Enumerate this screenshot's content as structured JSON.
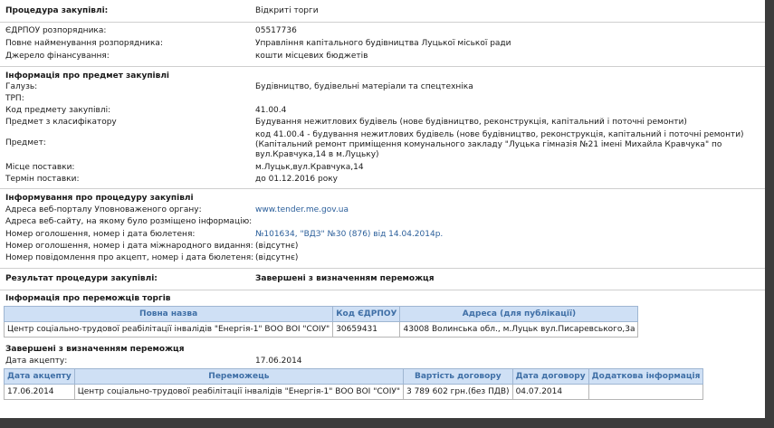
{
  "procurement": {
    "procedure_label": "Процедура закупівлі:",
    "procedure_value": "Відкриті торги",
    "edrpou_label": "ЄДРПОУ розпорядника:",
    "edrpou_value": "05517736",
    "full_name_label": "Повне найменування розпорядника:",
    "full_name_value": "Управління капітального будівництва Луцької міської ради",
    "funding_label": "Джерело фінансування:",
    "funding_value": "кошти місцевих бюджетів"
  },
  "subject": {
    "heading": "Інформація про предмет закупівлі",
    "industry_label": "Галузь:",
    "industry_value": "Будівництво, будівельні матеріали та спецтехніка",
    "trp_label": "ТРП:",
    "code_label": "Код предмету закупівлі:",
    "code_value": "41.00.4",
    "classifier_label": "Предмет з класифікатору",
    "classifier_value": "Будування нежитлових будівель (нове будівництво, реконструкція, капітальний і поточні ремонти)",
    "subject_label": "Предмет:",
    "subject_line1": "код 41.00.4 - будування нежитлових будівель (нове будівництво, реконструкція, капітальний і поточні ремонти)",
    "subject_line2": "(Капітальний ремонт приміщення комунального закладу \"Луцька гімназія №21 імені Михайла Кравчука\" по",
    "subject_line3": "вул.Кравчука,14 в м.Луцьку)",
    "place_label": "Місце поставки:",
    "place_value": "м.Луцьк,вул.Кравчука,14",
    "term_label": "Термін поставки:",
    "term_value": "до 01.12.2016 року"
  },
  "informing": {
    "heading": "Інформування про процедуру закупівлі",
    "portal_label": "Адреса веб-порталу Уповноваженого органу:",
    "portal_value": "www.tender.me.gov.ua",
    "site_label": "Адреса веб-сайту, на якому було розміщено інформацію:",
    "notice_label": "Номер оголошення, номер і дата бюлетеня:",
    "notice_value": "№101634, \"ВДЗ\" №30 (876) від 14.04.2014р.",
    "intl_label": "Номер оголошення, номер і дата міжнародного видання:",
    "intl_value": "(відсутнє)",
    "accept_label": "Номер повідомлення про акцепт, номер і дата бюлетеня:",
    "accept_value": "(відсутнє)"
  },
  "result": {
    "label": "Результат процедури закупівлі:",
    "value": "Завершені з визначенням переможця"
  },
  "winners": {
    "heading": "Інформація про переможців торгів",
    "columns": [
      "Повна назва",
      "Код ЄДРПОУ",
      "Адреса (для публікації)"
    ],
    "row": [
      "Центр соціально-трудової реабілітації інвалідів \"Енергія-1\" ВОО ВОІ \"СОІУ\"",
      "30659431",
      "43008 Волинська обл., м.Луцьк вул.Писаревського,3а"
    ]
  },
  "completed": {
    "heading": "Завершені з визначенням переможця",
    "accept_date_label": "Дата акцепту:",
    "accept_date_value": "17.06.2014",
    "columns": [
      "Дата акцепту",
      "Переможець",
      "Вартість договору",
      "Дата договору",
      "Додаткова інформація"
    ],
    "row": [
      "17.06.2014",
      "Центр соціально-трудової реабілітації інвалідів \"Енергія-1\" ВОО ВОІ \"СОІУ\"",
      "3 789 602 грн.(без ПДВ)",
      "04.07.2014",
      ""
    ]
  }
}
